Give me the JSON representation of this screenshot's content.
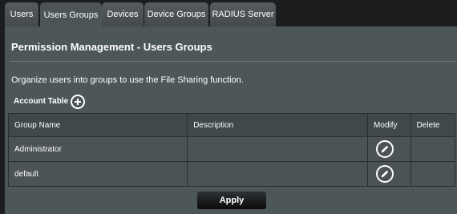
{
  "tabs": [
    {
      "label": "Users",
      "active": false
    },
    {
      "label": "Users Groups",
      "active": true
    },
    {
      "label": "Devices",
      "active": false
    },
    {
      "label": "Device Groups",
      "active": false
    },
    {
      "label": "RADIUS Server",
      "active": false
    }
  ],
  "panel": {
    "title": "Permission Management - Users Groups",
    "description": "Organize users into groups to use the File Sharing function.",
    "account_table_label": "Account Table",
    "add_icon": "plus-circle-icon"
  },
  "table": {
    "headers": [
      "Group Name",
      "Description",
      "Modify",
      "Delete"
    ],
    "rows": [
      {
        "group_name": "Administrator",
        "description": "",
        "modify_icon": "edit-icon"
      },
      {
        "group_name": "default",
        "description": "",
        "modify_icon": "edit-icon"
      }
    ]
  },
  "apply_label": "Apply",
  "colors": {
    "background": "#1c1d1e",
    "panel": "#4d5659",
    "tab": "#4f5659",
    "table_header": "#3f484b"
  }
}
